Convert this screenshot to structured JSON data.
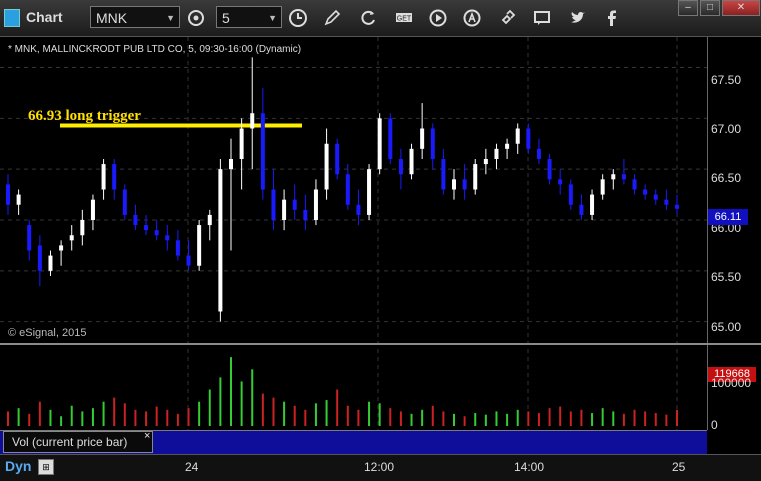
{
  "toolbar": {
    "title": "Chart",
    "symbol": "MNK",
    "interval": "5",
    "icons": [
      "gear-icon",
      "clock-icon",
      "pencil-icon",
      "refresh-icon",
      "get-icon",
      "play-icon",
      "alert-icon",
      "link-icon",
      "chat-icon",
      "twitter-icon",
      "facebook-icon"
    ],
    "window_buttons": [
      "–",
      "□",
      "✕"
    ]
  },
  "chart": {
    "header": "* MNK, MALLINCKRODT PUB LTD CO, 5, 09:30-16:00 (Dynamic)",
    "copyright": "© eSignal, 2015",
    "annotation": "66.93 long trigger",
    "current_price": "66.11",
    "current_volume": "119668",
    "price_labels": [
      "67.50",
      "67.00",
      "66.50",
      "66.00",
      "65.50",
      "65.00"
    ],
    "volume_labels": [
      "100000",
      "0"
    ],
    "volume_indicator_label": "Vol (current price bar)",
    "close_glyph": "×",
    "time_labels": [
      "24",
      "12:00",
      "14:00",
      "25"
    ],
    "footer": "Dyn",
    "colors": {
      "up": "#ffffff",
      "down": "#1a1aff",
      "trigger": "#ffee00",
      "vol_up": "#33cc33",
      "vol_down": "#cc2222"
    }
  },
  "chart_data": {
    "type": "candlestick",
    "ylim": [
      64.8,
      67.8
    ],
    "trigger_price": 66.93,
    "candles": [
      {
        "o": 66.35,
        "h": 66.45,
        "l": 66.05,
        "c": 66.15
      },
      {
        "o": 66.15,
        "h": 66.3,
        "l": 66.05,
        "c": 66.25
      },
      {
        "o": 65.95,
        "h": 66.0,
        "l": 65.6,
        "c": 65.7
      },
      {
        "o": 65.75,
        "h": 65.85,
        "l": 65.35,
        "c": 65.5
      },
      {
        "o": 65.5,
        "h": 65.7,
        "l": 65.45,
        "c": 65.65
      },
      {
        "o": 65.7,
        "h": 65.8,
        "l": 65.55,
        "c": 65.75
      },
      {
        "o": 65.8,
        "h": 65.95,
        "l": 65.7,
        "c": 65.85
      },
      {
        "o": 65.85,
        "h": 66.1,
        "l": 65.75,
        "c": 66.0
      },
      {
        "o": 66.0,
        "h": 66.25,
        "l": 65.9,
        "c": 66.2
      },
      {
        "o": 66.3,
        "h": 66.6,
        "l": 66.2,
        "c": 66.55
      },
      {
        "o": 66.55,
        "h": 66.6,
        "l": 66.2,
        "c": 66.3
      },
      {
        "o": 66.3,
        "h": 66.35,
        "l": 66.0,
        "c": 66.05
      },
      {
        "o": 66.05,
        "h": 66.15,
        "l": 65.9,
        "c": 65.95
      },
      {
        "o": 65.95,
        "h": 66.05,
        "l": 65.85,
        "c": 65.9
      },
      {
        "o": 65.9,
        "h": 66.0,
        "l": 65.8,
        "c": 65.85
      },
      {
        "o": 65.85,
        "h": 65.95,
        "l": 65.7,
        "c": 65.8
      },
      {
        "o": 65.8,
        "h": 65.9,
        "l": 65.6,
        "c": 65.65
      },
      {
        "o": 65.65,
        "h": 65.8,
        "l": 65.5,
        "c": 65.55
      },
      {
        "o": 65.55,
        "h": 66.0,
        "l": 65.5,
        "c": 65.95
      },
      {
        "o": 65.95,
        "h": 66.1,
        "l": 65.8,
        "c": 66.05
      },
      {
        "o": 65.1,
        "h": 66.6,
        "l": 65.0,
        "c": 66.5
      },
      {
        "o": 66.5,
        "h": 66.8,
        "l": 65.7,
        "c": 66.6
      },
      {
        "o": 66.6,
        "h": 67.0,
        "l": 66.3,
        "c": 66.9
      },
      {
        "o": 66.9,
        "h": 67.6,
        "l": 66.5,
        "c": 67.05
      },
      {
        "o": 67.05,
        "h": 67.3,
        "l": 66.2,
        "c": 66.3
      },
      {
        "o": 66.3,
        "h": 66.5,
        "l": 65.9,
        "c": 66.0
      },
      {
        "o": 66.0,
        "h": 66.3,
        "l": 65.9,
        "c": 66.2
      },
      {
        "o": 66.2,
        "h": 66.35,
        "l": 66.0,
        "c": 66.1
      },
      {
        "o": 66.1,
        "h": 66.25,
        "l": 65.9,
        "c": 66.0
      },
      {
        "o": 66.0,
        "h": 66.4,
        "l": 65.95,
        "c": 66.3
      },
      {
        "o": 66.3,
        "h": 66.9,
        "l": 66.2,
        "c": 66.75
      },
      {
        "o": 66.75,
        "h": 66.8,
        "l": 66.4,
        "c": 66.45
      },
      {
        "o": 66.45,
        "h": 66.55,
        "l": 66.1,
        "c": 66.15
      },
      {
        "o": 66.15,
        "h": 66.3,
        "l": 65.95,
        "c": 66.05
      },
      {
        "o": 66.05,
        "h": 66.55,
        "l": 66.0,
        "c": 66.5
      },
      {
        "o": 66.5,
        "h": 67.05,
        "l": 66.45,
        "c": 67.0
      },
      {
        "o": 67.0,
        "h": 67.05,
        "l": 66.55,
        "c": 66.6
      },
      {
        "o": 66.6,
        "h": 66.7,
        "l": 66.3,
        "c": 66.45
      },
      {
        "o": 66.45,
        "h": 66.75,
        "l": 66.4,
        "c": 66.7
      },
      {
        "o": 66.7,
        "h": 67.15,
        "l": 66.6,
        "c": 66.9
      },
      {
        "o": 66.9,
        "h": 66.95,
        "l": 66.5,
        "c": 66.6
      },
      {
        "o": 66.6,
        "h": 66.7,
        "l": 66.25,
        "c": 66.3
      },
      {
        "o": 66.3,
        "h": 66.5,
        "l": 66.2,
        "c": 66.4
      },
      {
        "o": 66.4,
        "h": 66.55,
        "l": 66.2,
        "c": 66.3
      },
      {
        "o": 66.3,
        "h": 66.6,
        "l": 66.25,
        "c": 66.55
      },
      {
        "o": 66.55,
        "h": 66.7,
        "l": 66.45,
        "c": 66.6
      },
      {
        "o": 66.6,
        "h": 66.75,
        "l": 66.5,
        "c": 66.7
      },
      {
        "o": 66.7,
        "h": 66.8,
        "l": 66.6,
        "c": 66.75
      },
      {
        "o": 66.75,
        "h": 66.95,
        "l": 66.65,
        "c": 66.9
      },
      {
        "o": 66.9,
        "h": 66.95,
        "l": 66.65,
        "c": 66.7
      },
      {
        "o": 66.7,
        "h": 66.8,
        "l": 66.55,
        "c": 66.6
      },
      {
        "o": 66.6,
        "h": 66.65,
        "l": 66.35,
        "c": 66.4
      },
      {
        "o": 66.4,
        "h": 66.5,
        "l": 66.25,
        "c": 66.35
      },
      {
        "o": 66.35,
        "h": 66.4,
        "l": 66.1,
        "c": 66.15
      },
      {
        "o": 66.15,
        "h": 66.25,
        "l": 66.0,
        "c": 66.05
      },
      {
        "o": 66.05,
        "h": 66.3,
        "l": 66.0,
        "c": 66.25
      },
      {
        "o": 66.25,
        "h": 66.45,
        "l": 66.2,
        "c": 66.4
      },
      {
        "o": 66.4,
        "h": 66.5,
        "l": 66.3,
        "c": 66.45
      },
      {
        "o": 66.45,
        "h": 66.6,
        "l": 66.35,
        "c": 66.4
      },
      {
        "o": 66.4,
        "h": 66.45,
        "l": 66.25,
        "c": 66.3
      },
      {
        "o": 66.3,
        "h": 66.35,
        "l": 66.2,
        "c": 66.25
      },
      {
        "o": 66.25,
        "h": 66.3,
        "l": 66.15,
        "c": 66.2
      },
      {
        "o": 66.2,
        "h": 66.3,
        "l": 66.1,
        "c": 66.15
      },
      {
        "o": 66.15,
        "h": 66.25,
        "l": 66.05,
        "c": 66.11
      }
    ],
    "volumes": [
      18,
      22,
      15,
      30,
      20,
      12,
      25,
      18,
      22,
      30,
      35,
      28,
      20,
      18,
      24,
      20,
      15,
      22,
      30,
      45,
      60,
      85,
      55,
      70,
      40,
      35,
      30,
      25,
      20,
      28,
      32,
      45,
      25,
      20,
      30,
      28,
      22,
      18,
      15,
      20,
      25,
      18,
      15,
      12,
      16,
      14,
      18,
      15,
      20,
      18,
      16,
      22,
      24,
      18,
      20,
      16,
      22,
      18,
      15,
      20,
      18,
      16,
      14,
      20
    ]
  }
}
